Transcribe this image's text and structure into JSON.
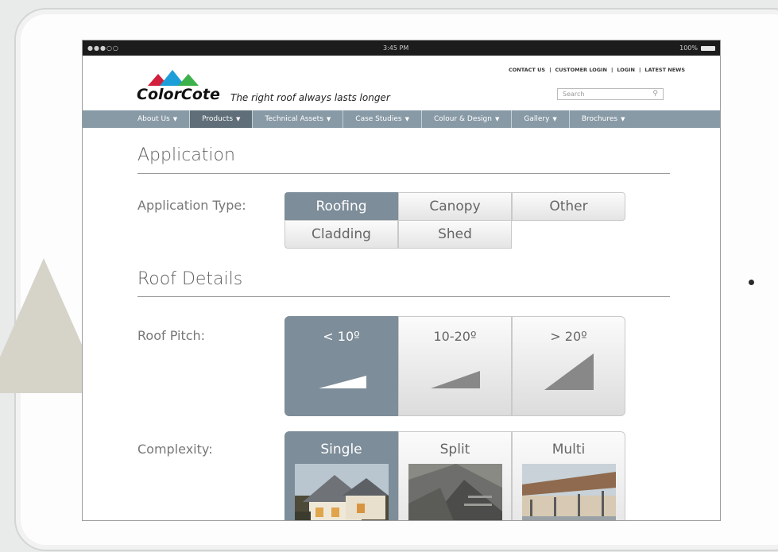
{
  "status": {
    "time": "3:45 PM",
    "battery": "100%",
    "signal": "●●●○○"
  },
  "toplinks": [
    "CONTACT US",
    "CUSTOMER LOGIN",
    "LOGIN",
    "LATEST NEWS"
  ],
  "brand": {
    "name": "ColorCote",
    "tagline": "The right roof always lasts longer"
  },
  "search": {
    "placeholder": "Search"
  },
  "nav": [
    {
      "label": "About Us"
    },
    {
      "label": "Products"
    },
    {
      "label": "Technical Assets"
    },
    {
      "label": "Case Studies"
    },
    {
      "label": "Colour & Design"
    },
    {
      "label": "Gallery"
    },
    {
      "label": "Brochures"
    }
  ],
  "application": {
    "title": "Application",
    "type_label": "Application Type:",
    "options": [
      "Roofing",
      "Canopy",
      "Other",
      "Cladding",
      "Shed"
    ],
    "selected": "Roofing"
  },
  "roof": {
    "title": "Roof Details",
    "pitch_label": "Roof Pitch:",
    "pitch_options": [
      "< 10º",
      "10-20º",
      "> 20º"
    ],
    "pitch_selected": "< 10º",
    "complexity_label": "Complexity:",
    "complexity_options": [
      "Single",
      "Split",
      "Multi"
    ],
    "complexity_selected": "Single"
  },
  "colors": {
    "nav": "#889aa6",
    "selected": "#7d8d99",
    "red": "#d21f3c",
    "blue": "#1c9ed8",
    "green": "#3db24a"
  }
}
